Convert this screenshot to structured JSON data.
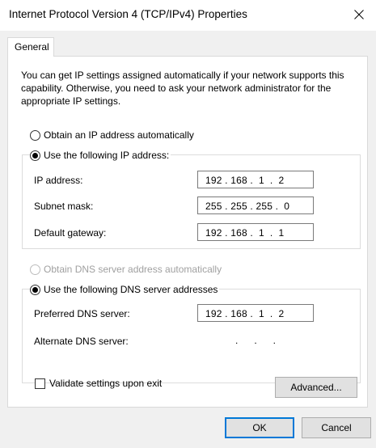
{
  "window": {
    "title": "Internet Protocol Version 4 (TCP/IPv4) Properties",
    "close_icon": "close-icon"
  },
  "tabs": [
    {
      "label": "General",
      "selected": true
    }
  ],
  "description": "You can get IP settings assigned automatically if your network supports this capability. Otherwise, you need to ask your network administrator for the appropriate IP settings.",
  "ip_section": {
    "auto_option": {
      "label": "Obtain an IP address automatically",
      "checked": false
    },
    "manual_option": {
      "label": "Use the following IP address:",
      "checked": true
    },
    "ip_address": {
      "label": "IP address:",
      "value": "192 . 168 .  1  .  2"
    },
    "subnet_mask": {
      "label": "Subnet mask:",
      "value": "255 . 255 . 255 .  0"
    },
    "default_gateway": {
      "label": "Default gateway:",
      "value": "192 . 168 .  1  .  1"
    }
  },
  "dns_section": {
    "auto_option": {
      "label": "Obtain DNS server address automatically",
      "checked": false,
      "disabled": true
    },
    "manual_option": {
      "label": "Use the following DNS server addresses",
      "checked": true
    },
    "preferred": {
      "label": "Preferred DNS server:",
      "value": "192 . 168 .  1  .  2"
    },
    "alternate": {
      "label": "Alternate DNS server:",
      "value": ".      .      ."
    }
  },
  "validate": {
    "label": "Validate settings upon exit",
    "checked": false
  },
  "buttons": {
    "advanced": "Advanced...",
    "ok": "OK",
    "cancel": "Cancel"
  },
  "colors": {
    "accent": "#0078d7",
    "dialog_bg": "#f0f0f0",
    "disabled_text": "#a0a0a0"
  }
}
